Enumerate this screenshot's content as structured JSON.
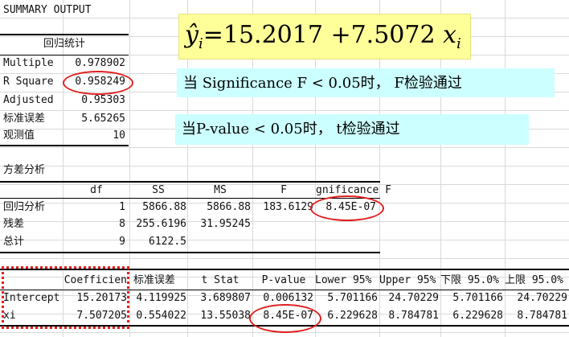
{
  "summary_title": "SUMMARY OUTPUT",
  "regression_stats": {
    "header": "回归统计",
    "rows": [
      {
        "label": "Multiple",
        "value": "0.978902"
      },
      {
        "label": "R Square",
        "value": "0.958249"
      },
      {
        "label": "Adjusted",
        "value": "0.95303"
      },
      {
        "label": "标准误差",
        "value": "5.65265"
      },
      {
        "label": "观测值",
        "value": "10"
      }
    ]
  },
  "formula": {
    "lhs": "ŷ",
    "lhs_sub": "i",
    "eq": "=15.2017  +7.5072 ",
    "var": "x",
    "var_sub": "i"
  },
  "notes": {
    "f_test": "当 Significance F < 0.05时， F检验通过",
    "t_test": "当P-value < 0.05时，  t检验通过"
  },
  "anova": {
    "title": "方差分析",
    "headers": [
      "df",
      "SS",
      "MS",
      "F",
      "gnificance F"
    ],
    "rows": [
      {
        "label": "回归分析",
        "df": "1",
        "ss": "5866.88",
        "ms": "5866.88",
        "f": "183.6129",
        "sig": "8.45E-07"
      },
      {
        "label": "残差",
        "df": "8",
        "ss": "255.6196",
        "ms": "31.95245",
        "f": "",
        "sig": ""
      },
      {
        "label": "总计",
        "df": "9",
        "ss": "6122.5",
        "ms": "",
        "f": "",
        "sig": ""
      }
    ]
  },
  "coef": {
    "headers": [
      "Coefficien",
      "标准误差",
      "t Stat",
      "P-value",
      "Lower 95%",
      "Upper 95%",
      "下限 95.0%",
      "上限 95.0%"
    ],
    "rows": [
      {
        "label": "Intercept",
        "values": [
          "15.20173",
          "4.119925",
          "3.689807",
          "0.006132",
          "5.701166",
          "24.70229",
          "5.701166",
          "24.70229"
        ]
      },
      {
        "label": "xi",
        "values": [
          "7.507205",
          "0.554022",
          "13.55038",
          "8.45E-07",
          "6.229628",
          "8.784781",
          "6.229628",
          "8.784781"
        ]
      }
    ]
  },
  "colors": {
    "highlight_yellow": "#ffff99",
    "highlight_cyan": "#ccffff",
    "annotation_red": "#e02020"
  }
}
